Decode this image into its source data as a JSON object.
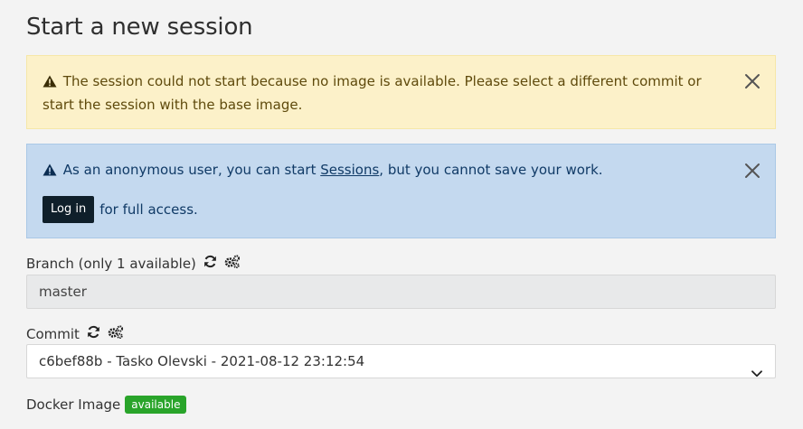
{
  "page": {
    "title": "Start a new session"
  },
  "warning_alert": {
    "icon": "warning-triangle-icon",
    "message": "The session could not start because no image is available. Please select a different commit or start the session with the base image."
  },
  "info_alert": {
    "icon": "warning-triangle-icon",
    "message_prefix": "As an anonymous user, you can start ",
    "link_label": "Sessions",
    "message_suffix": ", but you cannot save your work.",
    "login_label": "Log in",
    "login_suffix": "for full access."
  },
  "branch": {
    "label": "Branch (only 1 available)",
    "value": "master"
  },
  "commit": {
    "label": "Commit",
    "selected": "c6bef88b - Tasko Olevski - 2021-08-12 23:12:54"
  },
  "docker_image": {
    "label": "Docker Image",
    "status": "available"
  },
  "colors": {
    "warning_bg": "#fcf1c9",
    "info_bg": "#c4d9ef",
    "badge_green": "#29a42a",
    "login_bg": "#0f1f2a"
  }
}
